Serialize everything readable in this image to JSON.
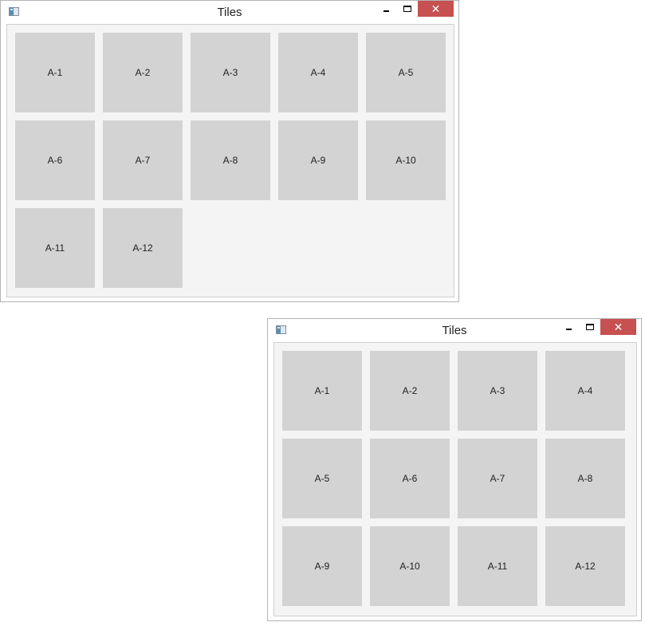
{
  "windows": [
    {
      "title": "Tiles",
      "close_glyph": "✕",
      "tiles": [
        "A-1",
        "A-2",
        "A-3",
        "A-4",
        "A-5",
        "A-6",
        "A-7",
        "A-8",
        "A-9",
        "A-10",
        "A-11",
        "A-12"
      ]
    },
    {
      "title": "Tiles",
      "close_glyph": "✕",
      "tiles": [
        "A-1",
        "A-2",
        "A-3",
        "A-4",
        "A-5",
        "A-6",
        "A-7",
        "A-8",
        "A-9",
        "A-10",
        "A-11",
        "A-12"
      ]
    }
  ],
  "colors": {
    "tile": "#d3d3d3",
    "content_bg": "#f4f4f4",
    "close_button": "#c75050"
  },
  "icons": {
    "app": "app-window-icon",
    "minimize": "minimize-icon",
    "maximize": "maximize-icon",
    "close": "close-icon"
  }
}
